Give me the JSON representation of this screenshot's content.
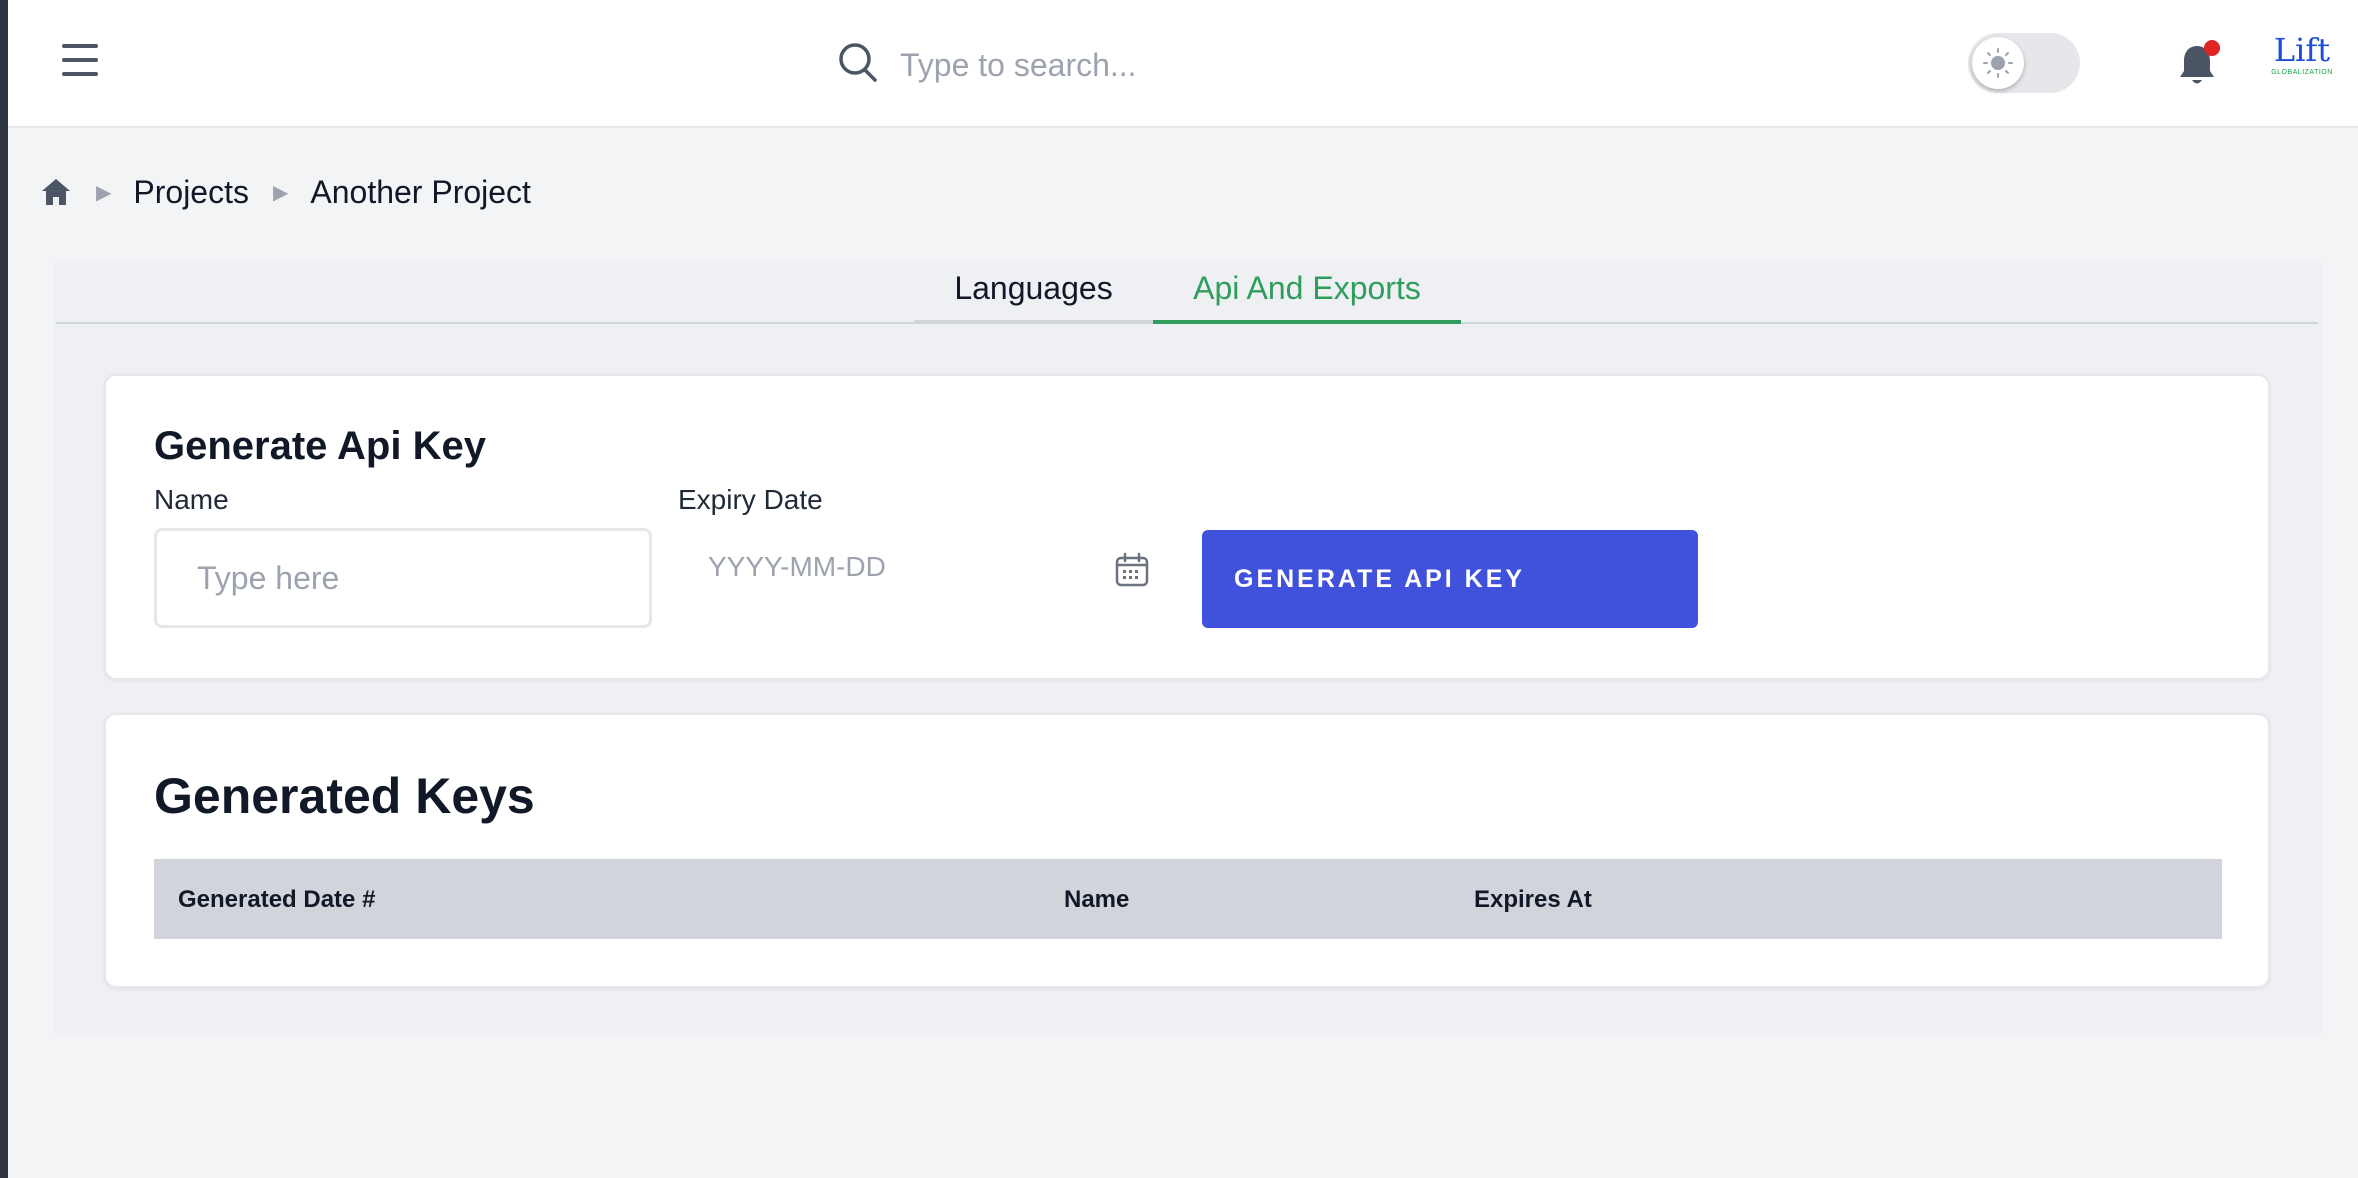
{
  "header": {
    "search_placeholder": "Type to search...",
    "logo_title": "Lift",
    "logo_subtitle": "GLOBALIZATION"
  },
  "breadcrumb": {
    "items": [
      "Projects",
      "Another Project"
    ]
  },
  "tabs": [
    {
      "label": "Languages",
      "active": false
    },
    {
      "label": "Api And Exports",
      "active": true
    }
  ],
  "generate": {
    "title": "Generate Api Key",
    "name_label": "Name",
    "name_placeholder": "Type here",
    "expiry_label": "Expiry Date",
    "expiry_placeholder": "YYYY-MM-DD",
    "button_label": "GENERATE API KEY"
  },
  "keys": {
    "title": "Generated Keys",
    "columns": [
      "Generated Date #",
      "Name",
      "Expires At"
    ],
    "rows": []
  },
  "colors": {
    "accent_green": "#2f9e5c",
    "button_blue": "#4051db",
    "notification_dot": "#e02424",
    "logo_blue": "#1d4ed8"
  }
}
